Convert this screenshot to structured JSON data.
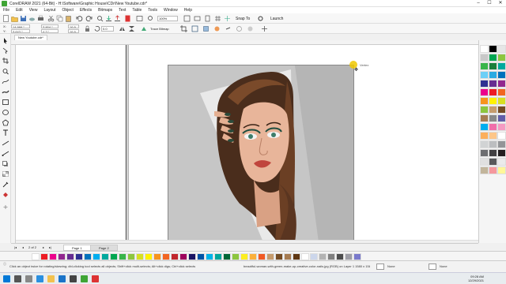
{
  "window": {
    "title": "CorelDRAW 2021 (64-Bit) - H:\\Software\\Graphic House\\CDr\\New Youtube.cdr*",
    "minimize": "–",
    "maximize": "☐",
    "close": "✕"
  },
  "menu": [
    "File",
    "Edit",
    "View",
    "Layout",
    "Object",
    "Effects",
    "Bitmaps",
    "Text",
    "Table",
    "Tools",
    "Window",
    "Help"
  ],
  "toolbar": {
    "zoom_value": "100%",
    "snap_to_label": "Snap To",
    "launch_label": "Launch"
  },
  "property_bar": {
    "x_value": "14.966 \"",
    "y_value": "3.642 \"",
    "w_value": "3.904 \"",
    "h_value": "4.2 \"",
    "scale_w": "16.9",
    "scale_h": "16.9",
    "angle": "0.0",
    "trace_bitmap_label": "Trace Bitmap"
  },
  "document": {
    "tab_label": "New Youtube.cdr*",
    "handle_label": "Vertex"
  },
  "pages": {
    "page1": "Page 1",
    "page2": "Page 2",
    "counter": "2 of 2"
  },
  "status": {
    "hint": "Click an object twice for rotating/skewing; dbl-clicking tool selects all objects; Shift+click multi-selects; Alt+click digs; Ctrl+click selects in a group",
    "object_info": "beautiful-woman-with-green-make-up-creative-color-nails.jpg (RGB) on Layer 1 1580 x 1580 dpi",
    "fill_label": "None",
    "outline_label": "None"
  },
  "clock": {
    "time": "09:28 AM",
    "date": "12/29/2021"
  },
  "colors": {
    "accent": "#3fa535",
    "handle": "#f0c800",
    "canvas_bg": "#ffffff",
    "bitmap_bg": "#c4c4c4"
  },
  "palette_right": [
    "#ffffff",
    "#000000",
    "#e6e6e6",
    "#c8c8c8",
    "#00a651",
    "#8dc63f",
    "#39b54a",
    "#1b7f3c",
    "#00a99d",
    "#6dcff6",
    "#29abe2",
    "#0072bc",
    "#2e3192",
    "#662d91",
    "#92278f",
    "#ec008c",
    "#ed1c24",
    "#f26522",
    "#f7941d",
    "#fff200",
    "#d7df23",
    "#8cc63f",
    "#c69c6d",
    "#754c24",
    "#a67c52",
    "#898989",
    "#605ca8",
    "#00aeef",
    "#f06eaa",
    "#f49ac2",
    "#fbaf5d",
    "#fdc689",
    "#ffffff",
    "#d1d3d4",
    "#bcbec0",
    "#939598",
    "#6d6e71",
    "#414042",
    "#231f20",
    "#e0e0e0",
    "#58595b",
    "#ebebeb",
    "#c2b59b",
    "#f5989d",
    "#fff799"
  ],
  "palette_bottom": [
    "#ffffff",
    "#ed1c24",
    "#ec008c",
    "#92278f",
    "#662d91",
    "#2e3192",
    "#0072bc",
    "#00aeef",
    "#00a99d",
    "#00a651",
    "#39b54a",
    "#8dc63f",
    "#d7df23",
    "#fff200",
    "#f7941d",
    "#f26522",
    "#c1272d",
    "#9e005d",
    "#1b1464",
    "#0054a6",
    "#00b4e9",
    "#00a79d",
    "#006837",
    "#8cc63f",
    "#fcee21",
    "#fbb03b",
    "#f15a24",
    "#c69c6d",
    "#754c24",
    "#a67c52",
    "#603813",
    "#ffffff",
    "#ccd6eb",
    "#b3b3b3",
    "#808080",
    "#4d4d4d",
    "#9e9ea6",
    "#7a7acc"
  ],
  "taskbar_icons": [
    "start-icon",
    "search-icon",
    "task-view-icon",
    "browser-icon",
    "folder-icon",
    "mail-icon",
    "store-icon",
    "coreldraw-icon",
    "media-icon"
  ]
}
